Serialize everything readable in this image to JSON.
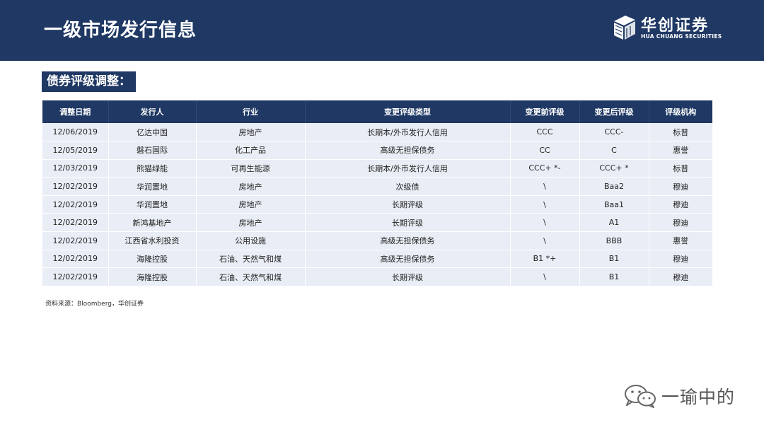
{
  "header": {
    "title": "一级市场发行信息",
    "logo_cn": "华创证券",
    "logo_en": "HUA CHUANG SECURITIES"
  },
  "section": {
    "title": "债券评级调整："
  },
  "table": {
    "columns": [
      "调整日期",
      "发行人",
      "行业",
      "变更评级类型",
      "变更前评级",
      "变更后评级",
      "评级机构"
    ],
    "rows": [
      [
        "12/06/2019",
        "亿达中国",
        "房地产",
        "长期本/外币发行人信用",
        "CCC",
        "CCC-",
        "标普"
      ],
      [
        "12/05/2019",
        "磐石国际",
        "化工产品",
        "高级无担保债务",
        "CC",
        "C",
        "惠誉"
      ],
      [
        "12/03/2019",
        "熊猫绿能",
        "可再生能源",
        "长期本/外币发行人信用",
        "CCC+ *-",
        "CCC+ *",
        "标普"
      ],
      [
        "12/02/2019",
        "华润置地",
        "房地产",
        "次级债",
        "\\",
        "Baa2",
        "穆迪"
      ],
      [
        "12/02/2019",
        "华润置地",
        "房地产",
        "长期评级",
        "\\",
        "Baa1",
        "穆迪"
      ],
      [
        "12/02/2019",
        "新鸿基地产",
        "房地产",
        "长期评级",
        "\\",
        "A1",
        "穆迪"
      ],
      [
        "12/02/2019",
        "江西省水利投资",
        "公用设施",
        "高级无担保债务",
        "\\",
        "BBB",
        "惠誉"
      ],
      [
        "12/02/2019",
        "海隆控股",
        "石油、天然气和煤",
        "高级无担保债务",
        "B1 *+",
        "B1",
        "穆迪"
      ],
      [
        "12/02/2019",
        "海隆控股",
        "石油、天然气和煤",
        "长期评级",
        "\\",
        "B1",
        "穆迪"
      ]
    ]
  },
  "source": "资料来源：Bloomberg，华创证券",
  "watermark": {
    "text": "一瑜中的",
    "icon": "wechat-icon"
  },
  "colors": {
    "navy": "#1f3864",
    "row_bg": "#e9edf5",
    "white": "#ffffff"
  }
}
